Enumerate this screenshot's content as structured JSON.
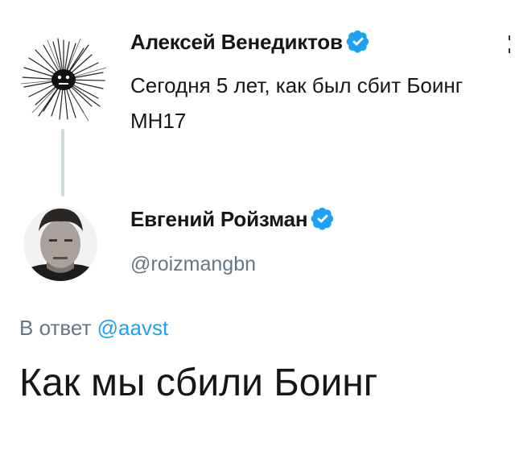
{
  "quoted_tweet": {
    "author_name": "Алексей Венедиктов",
    "text": "Сегодня 5 лет, как был сбит Боинг МН17"
  },
  "main_tweet": {
    "author_name": "Евгений Ройзман",
    "handle": "@roizmangbn",
    "reply_prefix": "В ответ",
    "reply_mention": "@aavst",
    "text": "Как мы сбили Боинг"
  },
  "colors": {
    "verified": "#1da1f2",
    "mention": "#1da1f2",
    "secondary_text": "#657786",
    "thread_line": "#cfd9de"
  },
  "icons": [
    "verified-badge-icon",
    "more-options-icon"
  ]
}
